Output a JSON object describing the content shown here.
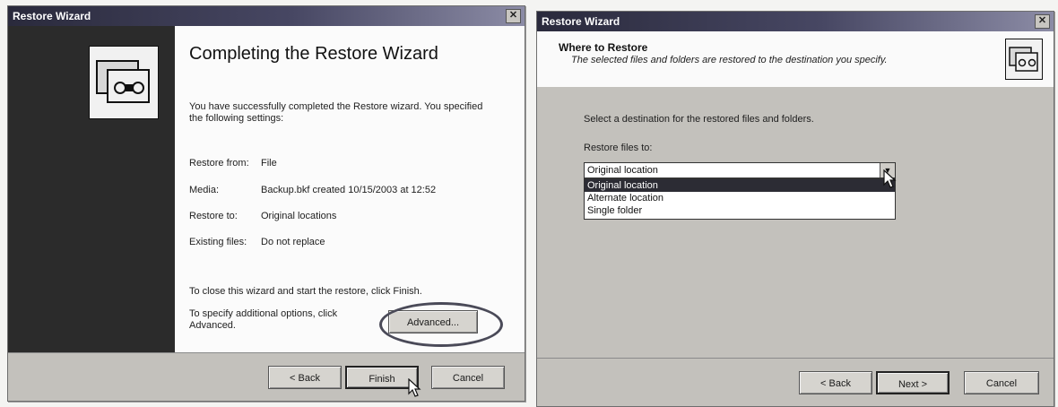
{
  "left_dialog": {
    "title": "Restore Wizard",
    "close_glyph": "✕",
    "heading": "Completing the Restore Wizard",
    "intro": "You have successfully completed the Restore wizard. You specified the following settings:",
    "settings": [
      {
        "label": "Restore from:",
        "value": "File"
      },
      {
        "label": "Media:",
        "value": "Backup.bkf created 10/15/2003 at 12:52"
      },
      {
        "label": "Restore to:",
        "value": "Original locations"
      },
      {
        "label": "Existing files:",
        "value": "Do not replace"
      }
    ],
    "close_text": "To close this wizard and start the restore, click Finish.",
    "advanced_text": "To specify additional options, click Advanced.",
    "buttons": {
      "advanced": "Advanced...",
      "back": "< Back",
      "finish": "Finish",
      "cancel": "Cancel"
    }
  },
  "right_dialog": {
    "title": "Restore Wizard",
    "close_glyph": "✕",
    "header_title": "Where to Restore",
    "header_subtitle": "The selected files and folders are restored to the destination you specify.",
    "instruction": "Select a destination for the restored files and folders.",
    "restore_label": "Restore files to:",
    "selected_value": "Original location",
    "options": [
      "Original location",
      "Alternate location",
      "Single folder"
    ],
    "buttons": {
      "back": "< Back",
      "next": "Next >",
      "cancel": "Cancel"
    }
  },
  "icons": [
    "wizard-art-icon",
    "close-icon",
    "dropdown-arrow-icon",
    "mouse-cursor-icon"
  ]
}
